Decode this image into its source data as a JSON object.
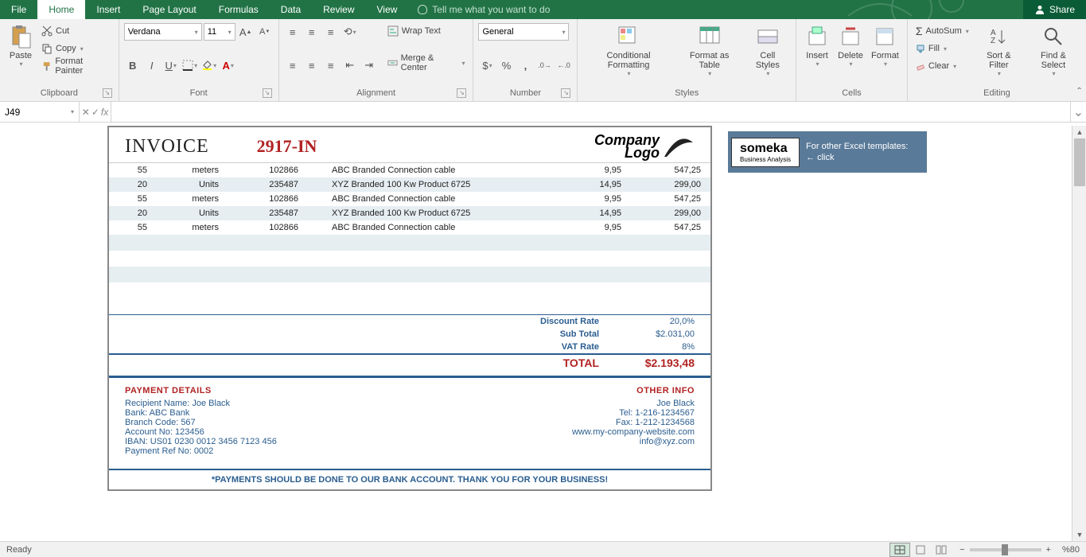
{
  "tabs": {
    "file": "File",
    "home": "Home",
    "insert": "Insert",
    "pagelayout": "Page Layout",
    "formulas": "Formulas",
    "data": "Data",
    "review": "Review",
    "view": "View",
    "tellme": "Tell me what you want to do",
    "share": "Share"
  },
  "ribbon": {
    "clipboard": {
      "label": "Clipboard",
      "paste": "Paste",
      "cut": "Cut",
      "copy": "Copy",
      "fmtpainter": "Format Painter"
    },
    "font": {
      "label": "Font",
      "name": "Verdana",
      "size": "11"
    },
    "alignment": {
      "label": "Alignment",
      "wrap": "Wrap Text",
      "merge": "Merge & Center"
    },
    "number": {
      "label": "Number",
      "format": "General"
    },
    "styles": {
      "label": "Styles",
      "cond": "Conditional Formatting",
      "table": "Format as Table",
      "cell": "Cell Styles"
    },
    "cells": {
      "label": "Cells",
      "insert": "Insert",
      "delete": "Delete",
      "format": "Format"
    },
    "editing": {
      "label": "Editing",
      "autosum": "AutoSum",
      "fill": "Fill",
      "clear": "Clear",
      "sort": "Sort & Filter",
      "find": "Find & Select"
    }
  },
  "formula": {
    "cell": "J49",
    "value": ""
  },
  "invoice": {
    "title": "INVOICE",
    "number": "2917-IN",
    "logo_line1": "Company",
    "logo_line2": "Logo",
    "rows": [
      {
        "qty": "55",
        "unit": "meters",
        "code": "102866",
        "desc": "ABC Branded Connection cable",
        "price": "9,95",
        "total": "547,25"
      },
      {
        "qty": "20",
        "unit": "Units",
        "code": "235487",
        "desc": "XYZ Branded 100 Kw Product 6725",
        "price": "14,95",
        "total": "299,00"
      },
      {
        "qty": "55",
        "unit": "meters",
        "code": "102866",
        "desc": "ABC Branded Connection cable",
        "price": "9,95",
        "total": "547,25"
      },
      {
        "qty": "20",
        "unit": "Units",
        "code": "235487",
        "desc": "XYZ Branded 100 Kw Product 6725",
        "price": "14,95",
        "total": "299,00"
      },
      {
        "qty": "55",
        "unit": "meters",
        "code": "102866",
        "desc": "ABC Branded Connection cable",
        "price": "9,95",
        "total": "547,25"
      }
    ],
    "discount_lbl": "Discount Rate",
    "discount_val": "20,0%",
    "subtotal_lbl": "Sub Total",
    "subtotal_val": "$2.031,00",
    "vat_lbl": "VAT Rate",
    "vat_val": "8%",
    "total_lbl": "TOTAL",
    "total_val": "$2.193,48",
    "payment_hdr": "PAYMENT DETAILS",
    "payment": {
      "l1": "Recipient Name: Joe Black",
      "l2": "Bank: ABC Bank",
      "l3": "Branch Code: 567",
      "l4": "Account No: 123456",
      "l5": "IBAN: US01 0230 0012 3456 7123 456",
      "l6": "Payment Ref No: 0002"
    },
    "other_hdr": "OTHER INFO",
    "other": {
      "l1": "Joe Black",
      "l2": "Tel: 1-216-1234567",
      "l3": "Fax: 1-212-1234568",
      "l4": "www.my-company-website.com",
      "l5": "info@xyz.com"
    },
    "footer": "*PAYMENTS SHOULD BE DONE TO OUR BANK ACCOUNT. THANK YOU FOR YOUR BUSINESS!"
  },
  "someka": {
    "brand": "someka",
    "sub": "Business Analysis",
    "l1": "For other Excel templates:",
    "l2": "← click"
  },
  "status": {
    "ready": "Ready",
    "zoom": "%80"
  }
}
